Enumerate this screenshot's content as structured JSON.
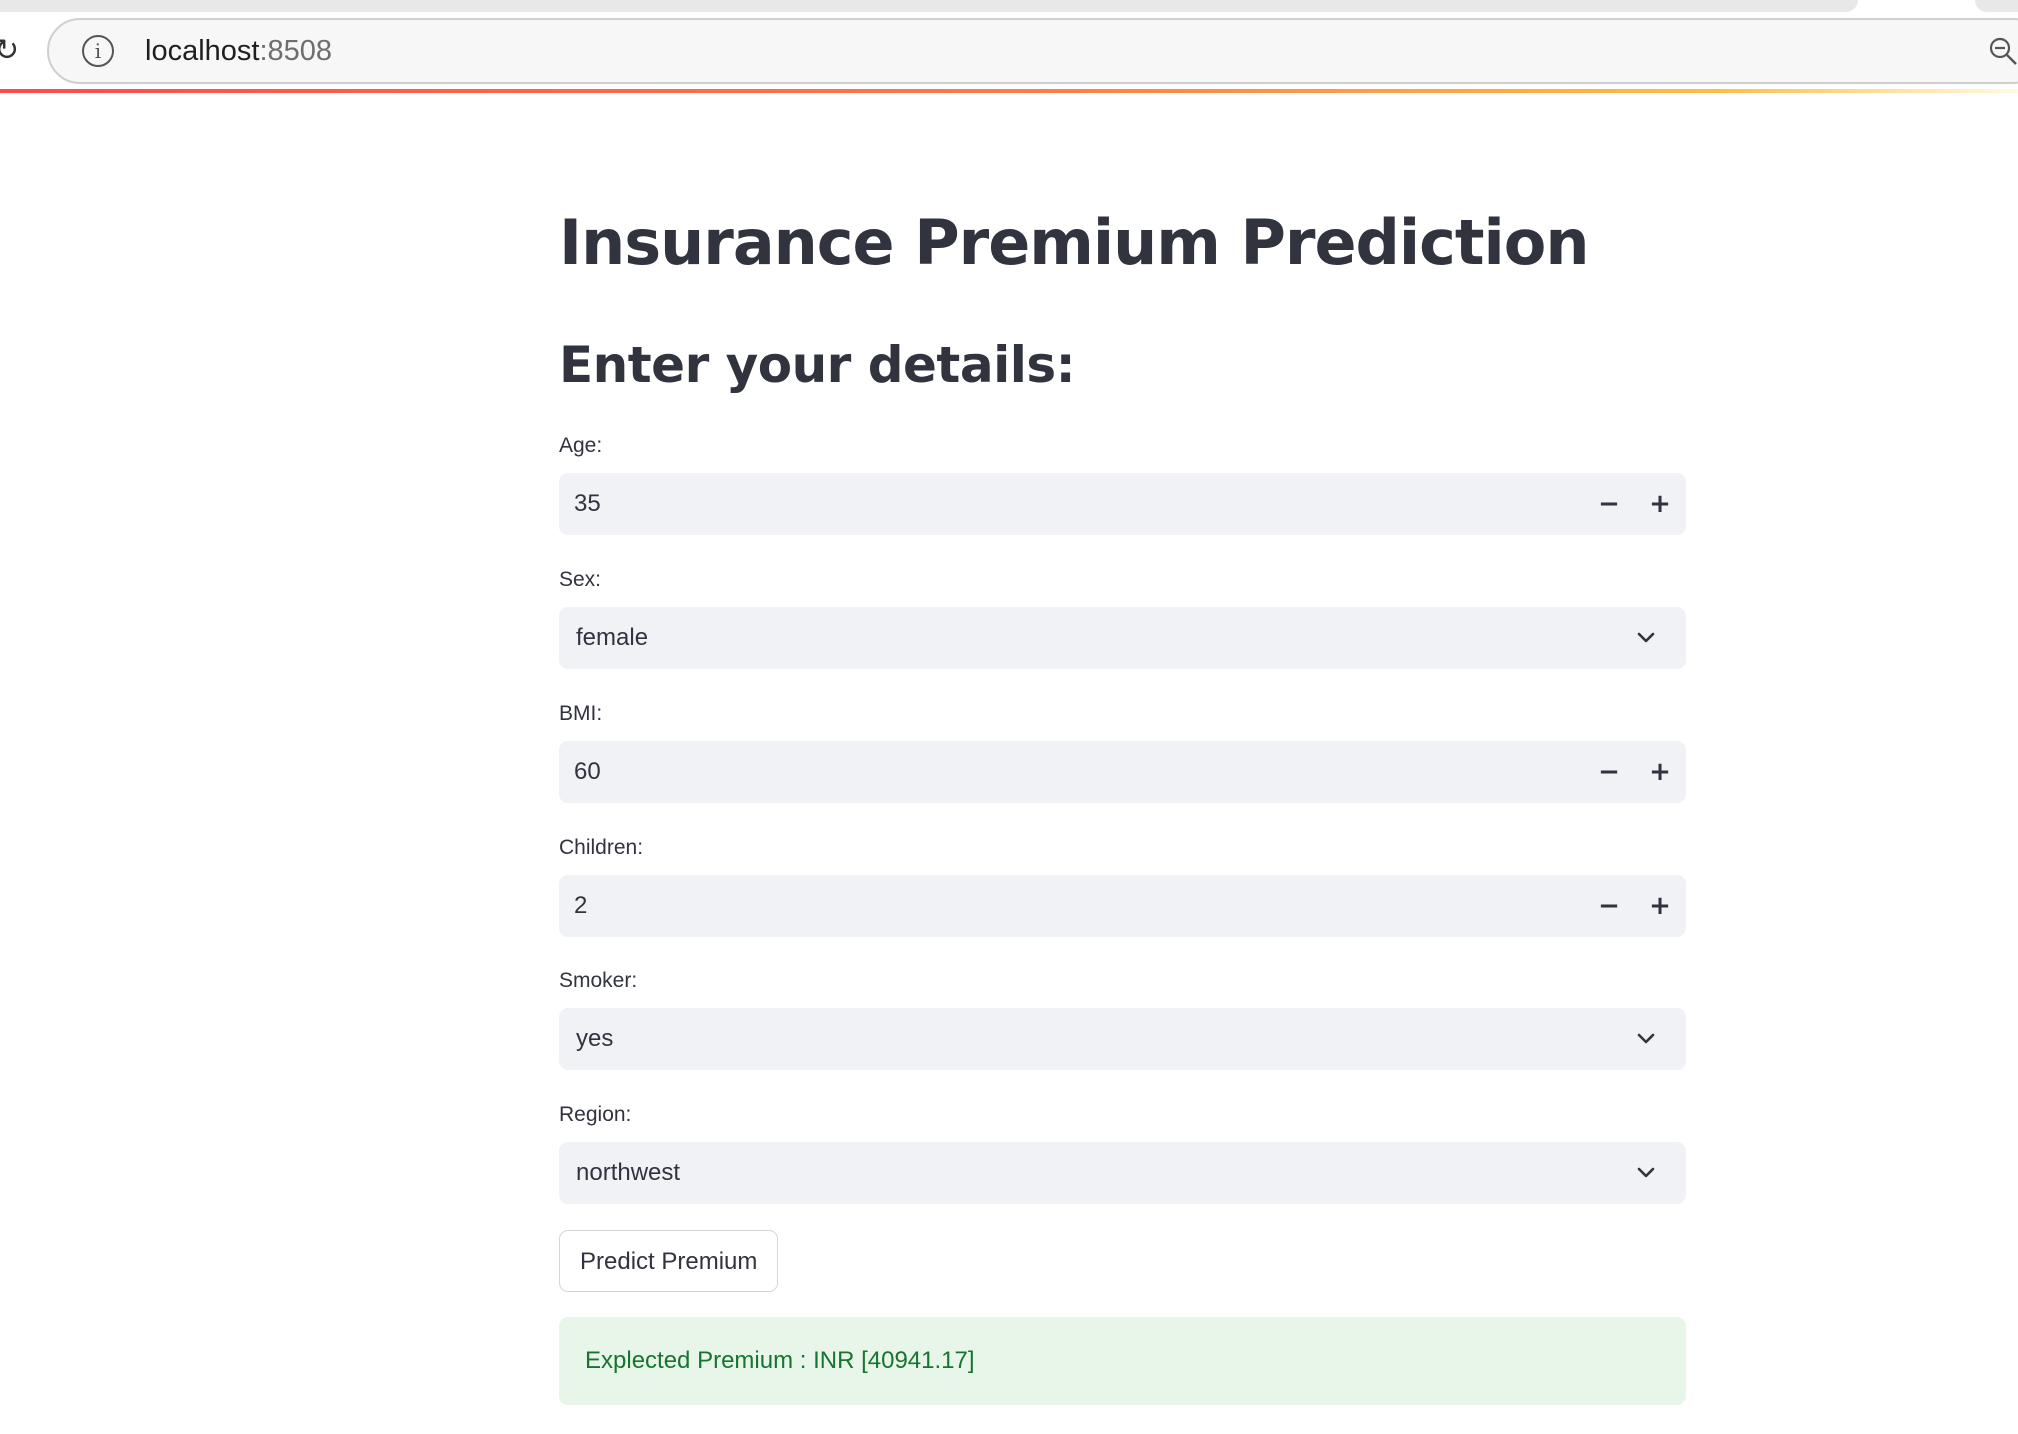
{
  "browser": {
    "url_host": "localhost",
    "url_port": ":8508",
    "reload_icon": "reload-icon",
    "info_icon": "info-icon",
    "zoom_icon": "zoom-out-icon"
  },
  "page": {
    "title": "Insurance Premium Prediction",
    "section_title": "Enter your details:"
  },
  "form": {
    "age": {
      "label": "Age:",
      "value": "35",
      "minus": "−",
      "plus": "+"
    },
    "sex": {
      "label": "Sex:",
      "value": "female"
    },
    "bmi": {
      "label": "BMI:",
      "value": "60",
      "minus": "−",
      "plus": "+"
    },
    "children": {
      "label": "Children:",
      "value": "2",
      "minus": "−",
      "plus": "+"
    },
    "smoker": {
      "label": "Smoker:",
      "value": "yes"
    },
    "region": {
      "label": "Region:",
      "value": "northwest"
    }
  },
  "actions": {
    "predict_label": "Predict Premium"
  },
  "result": {
    "text": "Explected Premium : INR [40941.17]"
  },
  "colors": {
    "text": "#31333f",
    "input_bg": "#f0f2f6",
    "success_bg": "#e8f6ea",
    "success_text": "#17752f",
    "accent": "#ff4b4b"
  }
}
